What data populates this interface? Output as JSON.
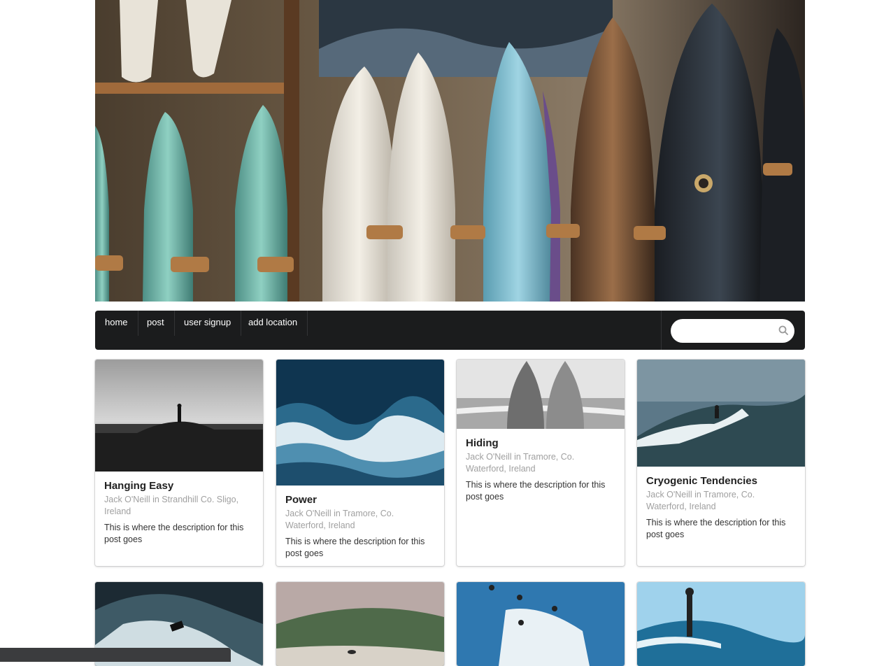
{
  "nav": {
    "items": [
      "home",
      "post",
      "user signup",
      "add location"
    ],
    "search_placeholder": ""
  },
  "posts": [
    {
      "title": "Hanging Easy",
      "meta": "Jack O'Neill in Strandhill Co. Sligo, Ireland",
      "description": "This is where the description for this post goes"
    },
    {
      "title": "Power",
      "meta": "Jack O'Neill in Tramore, Co. Waterford, Ireland",
      "description": "This is where the description for this post goes"
    },
    {
      "title": "Hiding",
      "meta": "Jack O'Neill in Tramore, Co. Waterford, Ireland",
      "description": "This is where the description for this post goes"
    },
    {
      "title": "Cryogenic Tendencies",
      "meta": "Jack O'Neill in Tramore, Co. Waterford, Ireland",
      "description": "This is where the description for this post goes"
    }
  ],
  "icons": {
    "search": "search-icon"
  }
}
